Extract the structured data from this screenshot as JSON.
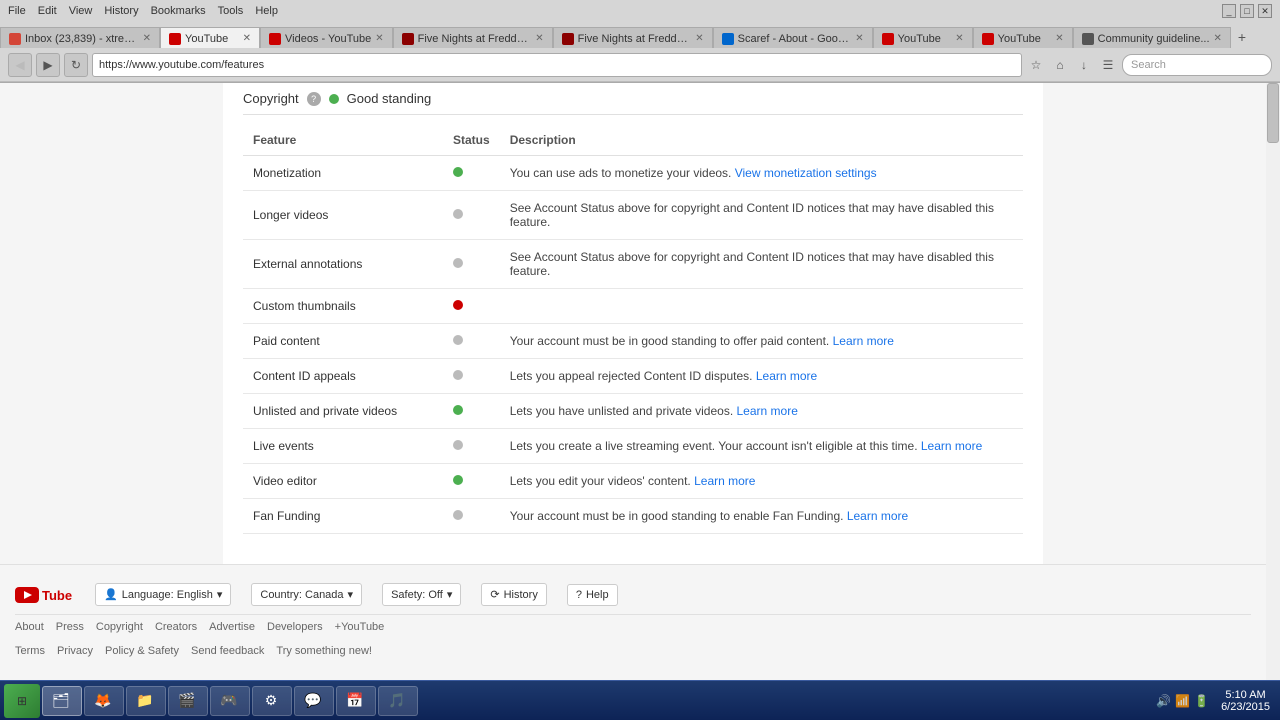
{
  "browser": {
    "title": "YouTube",
    "address": "https://www.youtube.com/features",
    "search_placeholder": "Search",
    "tabs": [
      {
        "id": "inbox",
        "title": "Inbox (23,839) - xtrem...",
        "type": "gmail",
        "active": false
      },
      {
        "id": "yt-features",
        "title": "YouTube",
        "type": "yt",
        "active": true
      },
      {
        "id": "videos-yt",
        "title": "Videos - YouTube",
        "type": "yt",
        "active": false
      },
      {
        "id": "fnaf1",
        "title": "Five Nights at Freddy'...",
        "type": "fnaf",
        "active": false
      },
      {
        "id": "fnaf2",
        "title": "Five Nights at Freddy'...",
        "type": "fnaf",
        "active": false
      },
      {
        "id": "scaref",
        "title": "Scaref - About - Goog...",
        "type": "scaref",
        "active": false
      },
      {
        "id": "yt2",
        "title": "YouTube",
        "type": "yt",
        "active": false
      },
      {
        "id": "yt3",
        "title": "YouTube",
        "type": "yt",
        "active": false
      },
      {
        "id": "community",
        "title": "Community guideline...",
        "type": "community",
        "active": false
      }
    ],
    "menus": [
      "File",
      "Edit",
      "View",
      "History",
      "Bookmarks",
      "Tools",
      "Help"
    ]
  },
  "copyright_row": {
    "label": "Copyright",
    "status": "Good standing",
    "status_dot": "green"
  },
  "table": {
    "headers": [
      "Feature",
      "Status",
      "Description"
    ],
    "rows": [
      {
        "feature": "Monetization",
        "status": "green",
        "description": "You can use ads to monetize your videos.",
        "link_text": "View monetization settings",
        "link_href": "#"
      },
      {
        "feature": "Longer videos",
        "status": "gray",
        "description": "See Account Status above for copyright and Content ID notices that may have disabled this feature.",
        "link_text": "",
        "link_href": ""
      },
      {
        "feature": "External annotations",
        "status": "gray",
        "description": "See Account Status above for copyright and Content ID notices that may have disabled this feature.",
        "link_text": "",
        "link_href": ""
      },
      {
        "feature": "Custom thumbnails",
        "status": "red",
        "description": "",
        "link_text": "",
        "link_href": ""
      },
      {
        "feature": "Paid content",
        "status": "gray",
        "description": "Your account must be in good standing to offer paid content.",
        "link_text": "Learn more",
        "link_href": "#"
      },
      {
        "feature": "Content ID appeals",
        "status": "gray",
        "description": "Lets you appeal rejected Content ID disputes.",
        "link_text": "Learn more",
        "link_href": "#"
      },
      {
        "feature": "Unlisted and private videos",
        "status": "green",
        "description": "Lets you have unlisted and private videos.",
        "link_text": "Learn more",
        "link_href": "#"
      },
      {
        "feature": "Live events",
        "status": "gray",
        "description": "Lets you create a live streaming event. Your account isn't eligible at this time.",
        "link_text": "Learn more",
        "link_href": "#"
      },
      {
        "feature": "Video editor",
        "status": "green",
        "description": "Lets you edit your videos' content.",
        "link_text": "Learn more",
        "link_href": "#"
      },
      {
        "feature": "Fan Funding",
        "status": "gray",
        "description": "Your account must be in good standing to enable Fan Funding.",
        "link_text": "Learn more",
        "link_href": "#"
      }
    ]
  },
  "footer": {
    "logo_text": "YouTube",
    "language_btn": "Language: English",
    "country_btn": "Country: Canada",
    "safety_btn": "Safety: Off",
    "history_btn": "History",
    "help_btn": "Help",
    "links": [
      "About",
      "Press",
      "Copyright",
      "Creators",
      "Advertise",
      "Developers",
      "+YouTube"
    ],
    "sublinks": [
      "Terms",
      "Privacy",
      "Policy & Safety",
      "Send feedback",
      "Try something new!"
    ]
  },
  "taskbar": {
    "time": "5:10 AM",
    "date": "6/23/2015",
    "items": [
      {
        "name": "start",
        "icon": "⊞"
      },
      {
        "name": "windows-explorer",
        "icon": "🗂"
      },
      {
        "name": "firefox",
        "icon": "🦊"
      },
      {
        "name": "file-manager",
        "icon": "📁"
      },
      {
        "name": "media",
        "icon": "🎬"
      },
      {
        "name": "app1",
        "icon": "🎮"
      },
      {
        "name": "util",
        "icon": "⚙"
      },
      {
        "name": "skype",
        "icon": "💬"
      },
      {
        "name": "calendar",
        "icon": "📅"
      },
      {
        "name": "music",
        "icon": "🎵"
      }
    ]
  }
}
